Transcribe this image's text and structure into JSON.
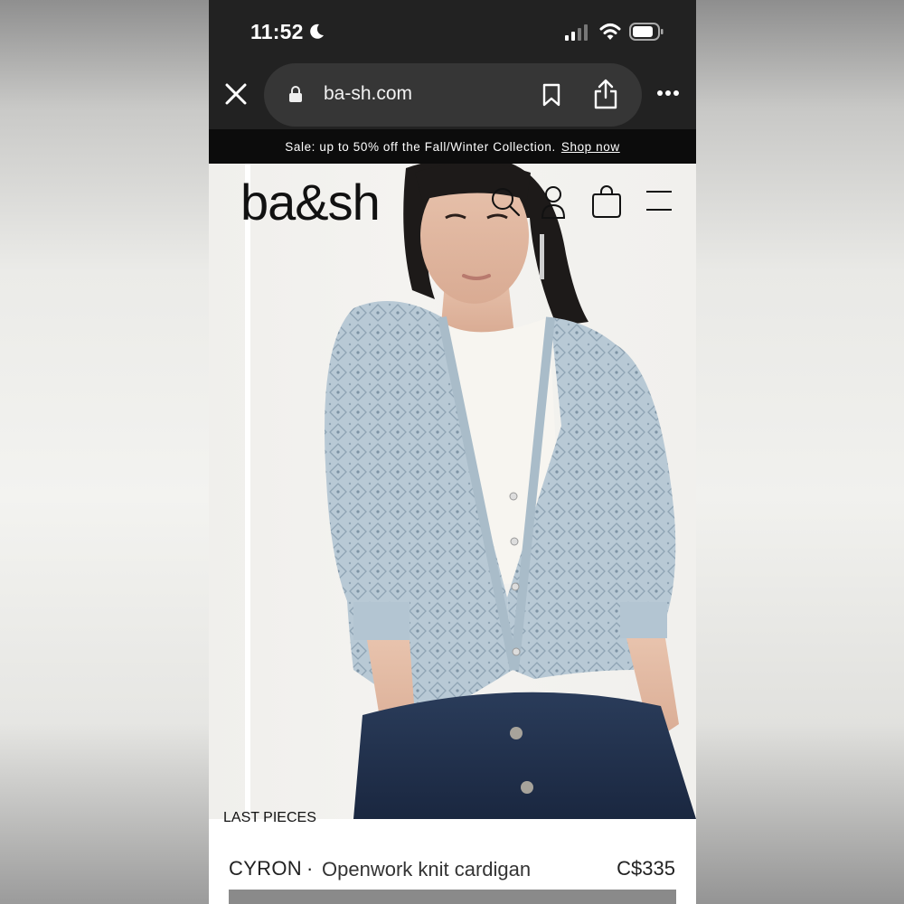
{
  "status_bar": {
    "time": "11:52",
    "icons": [
      "moon-icon",
      "signal-icon",
      "wifi-icon",
      "battery-icon"
    ]
  },
  "browser": {
    "url": "ba-sh.com",
    "icons": [
      "close-icon",
      "lock-icon",
      "bookmark-icon",
      "share-icon",
      "more-icon"
    ]
  },
  "promo": {
    "text": "Sale: up to 50% off the Fall/Winter Collection.",
    "link": "Shop now"
  },
  "header": {
    "logo": "ba&sh",
    "icons": [
      "search-icon",
      "account-icon",
      "bag-icon",
      "menu-icon"
    ]
  },
  "product": {
    "badge": "LAST PIECES",
    "name": "CYRON",
    "separator": "·",
    "description": "Openwork knit cardigan",
    "price": "C$335"
  },
  "colors": {
    "browser_chrome": "#222222",
    "url_pill": "#363636",
    "promo_bg": "#0c0c0c",
    "cardigan": "#b9cad6",
    "denim": "#1f2f4a"
  }
}
